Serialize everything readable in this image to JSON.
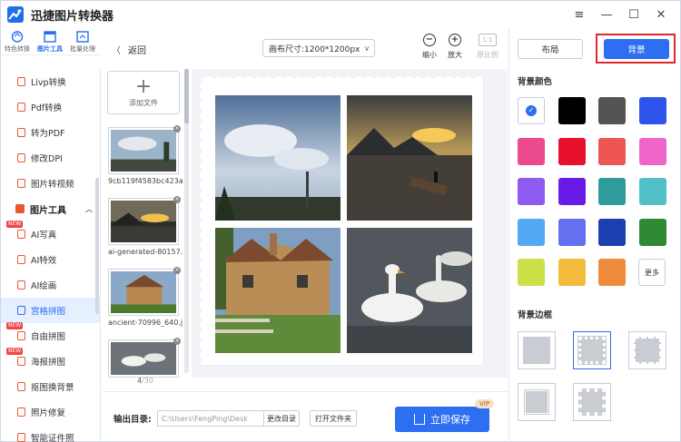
{
  "app": {
    "title": "迅捷图片转换器",
    "window_controls": {
      "menu": "≡",
      "minimize": "—",
      "maximize": "☐",
      "close": "✕"
    }
  },
  "rail_tabs": [
    {
      "label": "特色转换",
      "icon": "convert-icon"
    },
    {
      "label": "图片工具",
      "icon": "image-tools-icon",
      "active": true
    },
    {
      "label": "批量处理",
      "icon": "batch-icon"
    }
  ],
  "sidebar": {
    "items_top": [
      {
        "label": "Livp转换"
      },
      {
        "label": "Pdf转换"
      },
      {
        "label": "转为PDF"
      },
      {
        "label": "修改DPI"
      },
      {
        "label": "图片转视频"
      }
    ],
    "section": {
      "label": "图片工具",
      "chevron": "︿"
    },
    "items_tools": [
      {
        "label": "AI写真",
        "badge": "NEW"
      },
      {
        "label": "AI特效"
      },
      {
        "label": "AI绘画"
      },
      {
        "label": "宫格拼图",
        "active": true
      },
      {
        "label": "自由拼图",
        "badge": "NEW"
      },
      {
        "label": "海报拼图",
        "badge": "NEW"
      },
      {
        "label": "抠图换背景"
      },
      {
        "label": "照片修复"
      },
      {
        "label": "智能证件照"
      }
    ]
  },
  "toolbar": {
    "back_label": "返回",
    "canvas_size": "画布尺寸:1200*1200px",
    "zoom_out_label": "缩小",
    "zoom_in_label": "放大",
    "original_ratio_icon": "1:1",
    "original_ratio_label": "原比例"
  },
  "files": {
    "add_label": "添加文件",
    "thumbs": [
      {
        "name": "9cb119f4583bc423a..."
      },
      {
        "name": "ai-generated-80157..."
      },
      {
        "name": "ancient-70996_640.j..."
      },
      {
        "name": ""
      }
    ],
    "page_current": "4",
    "page_total": "/30"
  },
  "bottom": {
    "output_label": "输出目录:",
    "output_path": "C:\\Users\\FengPing\\Desk",
    "change_dir": "更改目录",
    "open_folder": "打开文件夹",
    "save_label": "立即保存",
    "vip_badge": "VIP"
  },
  "right_panel": {
    "tab_layout": "布局",
    "tab_background": "背景",
    "bg_color_title": "背景颜色",
    "colors": [
      "#ffffff",
      "#000000",
      "#545454",
      "#2f54eb",
      "#eb4a8c",
      "#e8102a",
      "#ee5555",
      "#ee66c8",
      "#8e5af1",
      "#6a1ae6",
      "#2f9b9b",
      "#52c0c9",
      "#54a9f5",
      "#6470f0",
      "#1e3fb0",
      "#2e8a35",
      "#cde04a",
      "#f4bc3f",
      "#ef8b3c"
    ],
    "more_label": "更多",
    "bg_border_title": "背景边框"
  }
}
